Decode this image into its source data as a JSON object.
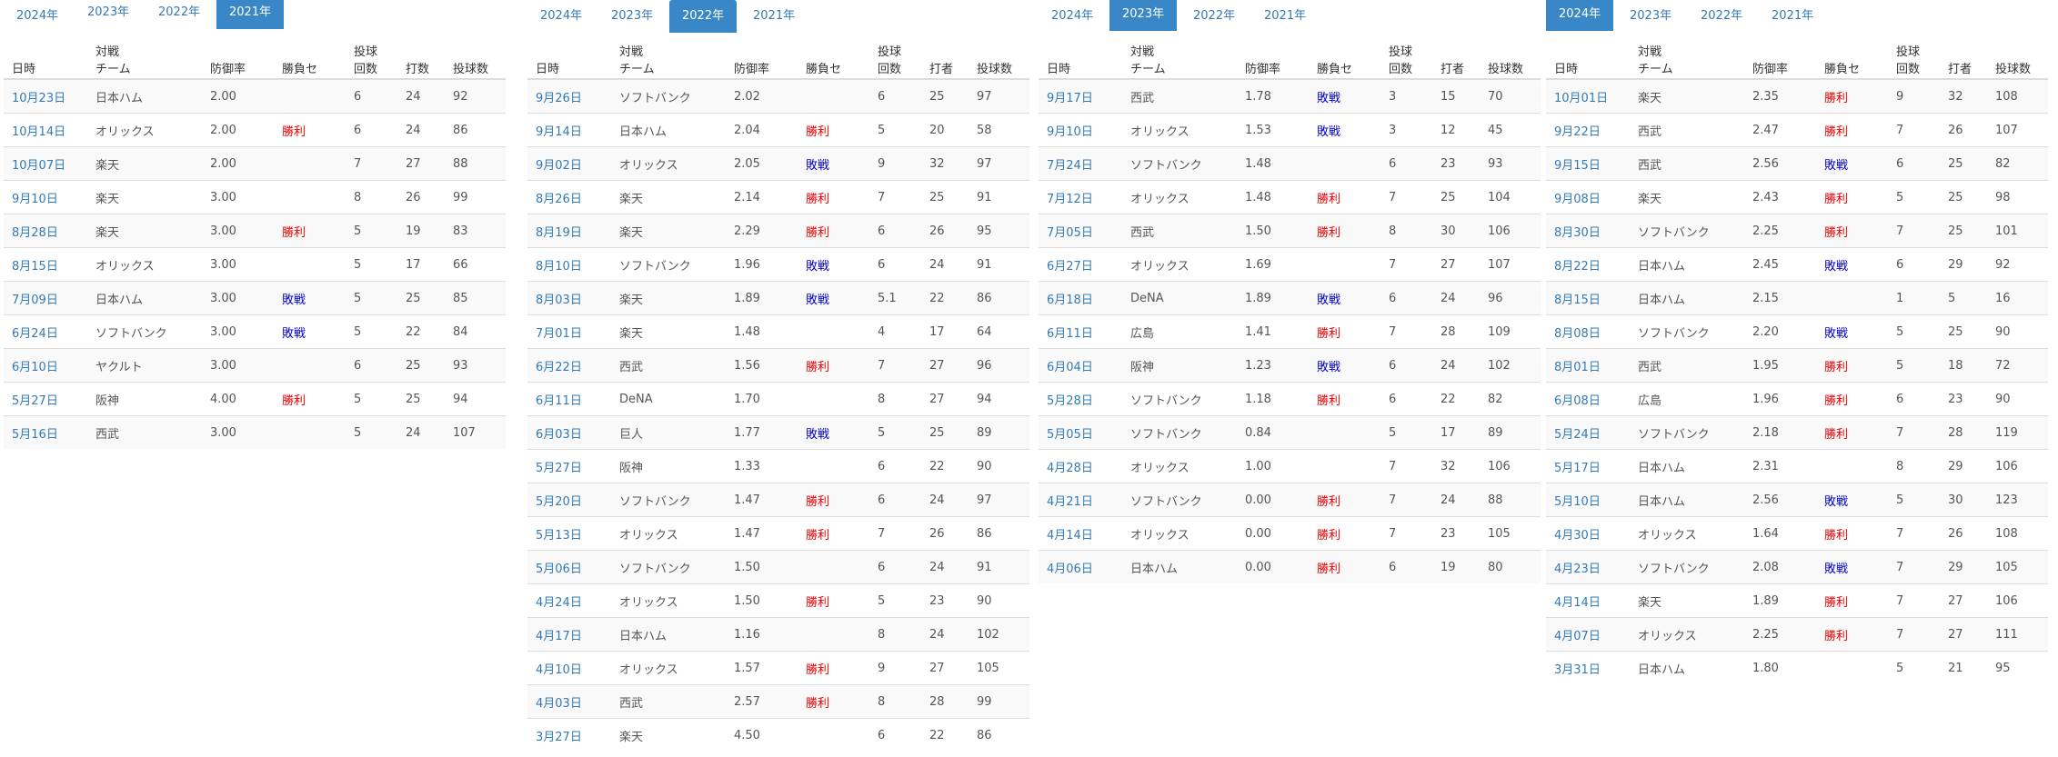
{
  "tabs": [
    "2024年",
    "2023年",
    "2022年",
    "2021年"
  ],
  "headers": {
    "date": "日時",
    "opponent_line1": "対戦",
    "opponent_line2": "チーム",
    "era": "防御率",
    "result": "勝負セ",
    "innings_line1": "投球",
    "innings_line2": "回数",
    "batters_a": "打数",
    "batters_b": "打者",
    "pitches": "投球数"
  },
  "panels": [
    {
      "active_tab": 3,
      "batters_header": "batters_a",
      "rows": [
        [
          "10月23日",
          "日本ハム",
          "2.00",
          "",
          "6",
          "24",
          "92"
        ],
        [
          "10月14日",
          "オリックス",
          "2.00",
          "勝利",
          "6",
          "24",
          "86"
        ],
        [
          "10月07日",
          "楽天",
          "2.00",
          "",
          "7",
          "27",
          "88"
        ],
        [
          "9月10日",
          "楽天",
          "3.00",
          "",
          "8",
          "26",
          "99"
        ],
        [
          "8月28日",
          "楽天",
          "3.00",
          "勝利",
          "5",
          "19",
          "83"
        ],
        [
          "8月15日",
          "オリックス",
          "3.00",
          "",
          "5",
          "17",
          "66"
        ],
        [
          "7月09日",
          "日本ハム",
          "3.00",
          "敗戦",
          "5",
          "25",
          "85"
        ],
        [
          "6月24日",
          "ソフトバンク",
          "3.00",
          "敗戦",
          "5",
          "22",
          "84"
        ],
        [
          "6月10日",
          "ヤクルト",
          "3.00",
          "",
          "6",
          "25",
          "93"
        ],
        [
          "5月27日",
          "阪神",
          "4.00",
          "勝利",
          "5",
          "25",
          "94"
        ],
        [
          "5月16日",
          "西武",
          "3.00",
          "",
          "5",
          "24",
          "107"
        ]
      ]
    },
    {
      "active_tab": 2,
      "batters_header": "batters_b",
      "rows": [
        [
          "9月26日",
          "ソフトバンク",
          "2.02",
          "",
          "6",
          "25",
          "97"
        ],
        [
          "9月14日",
          "日本ハム",
          "2.04",
          "勝利",
          "5",
          "20",
          "58"
        ],
        [
          "9月02日",
          "オリックス",
          "2.05",
          "敗戦",
          "9",
          "32",
          "97"
        ],
        [
          "8月26日",
          "楽天",
          "2.14",
          "勝利",
          "7",
          "25",
          "91"
        ],
        [
          "8月19日",
          "楽天",
          "2.29",
          "勝利",
          "6",
          "26",
          "95"
        ],
        [
          "8月10日",
          "ソフトバンク",
          "1.96",
          "敗戦",
          "6",
          "24",
          "91"
        ],
        [
          "8月03日",
          "楽天",
          "1.89",
          "敗戦",
          "5.1",
          "22",
          "86"
        ],
        [
          "7月01日",
          "楽天",
          "1.48",
          "",
          "4",
          "17",
          "64"
        ],
        [
          "6月22日",
          "西武",
          "1.56",
          "勝利",
          "7",
          "27",
          "96"
        ],
        [
          "6月11日",
          "DeNA",
          "1.70",
          "",
          "8",
          "27",
          "94"
        ],
        [
          "6月03日",
          "巨人",
          "1.77",
          "敗戦",
          "5",
          "25",
          "89"
        ],
        [
          "5月27日",
          "阪神",
          "1.33",
          "",
          "6",
          "22",
          "90"
        ],
        [
          "5月20日",
          "ソフトバンク",
          "1.47",
          "勝利",
          "6",
          "24",
          "97"
        ],
        [
          "5月13日",
          "オリックス",
          "1.47",
          "勝利",
          "7",
          "26",
          "86"
        ],
        [
          "5月06日",
          "ソフトバンク",
          "1.50",
          "",
          "6",
          "24",
          "91"
        ],
        [
          "4月24日",
          "オリックス",
          "1.50",
          "勝利",
          "5",
          "23",
          "90"
        ],
        [
          "4月17日",
          "日本ハム",
          "1.16",
          "",
          "8",
          "24",
          "102"
        ],
        [
          "4月10日",
          "オリックス",
          "1.57",
          "勝利",
          "9",
          "27",
          "105"
        ],
        [
          "4月03日",
          "西武",
          "2.57",
          "勝利",
          "8",
          "28",
          "99"
        ],
        [
          "3月27日",
          "楽天",
          "4.50",
          "",
          "6",
          "22",
          "86"
        ]
      ]
    },
    {
      "active_tab": 1,
      "batters_header": "batters_b",
      "rows": [
        [
          "9月17日",
          "西武",
          "1.78",
          "敗戦",
          "3",
          "15",
          "70"
        ],
        [
          "9月10日",
          "オリックス",
          "1.53",
          "敗戦",
          "3",
          "12",
          "45"
        ],
        [
          "7月24日",
          "ソフトバンク",
          "1.48",
          "",
          "6",
          "23",
          "93"
        ],
        [
          "7月12日",
          "オリックス",
          "1.48",
          "勝利",
          "7",
          "25",
          "104"
        ],
        [
          "7月05日",
          "西武",
          "1.50",
          "勝利",
          "8",
          "30",
          "106"
        ],
        [
          "6月27日",
          "オリックス",
          "1.69",
          "",
          "7",
          "27",
          "107"
        ],
        [
          "6月18日",
          "DeNA",
          "1.89",
          "敗戦",
          "6",
          "24",
          "96"
        ],
        [
          "6月11日",
          "広島",
          "1.41",
          "勝利",
          "7",
          "28",
          "109"
        ],
        [
          "6月04日",
          "阪神",
          "1.23",
          "敗戦",
          "6",
          "24",
          "102"
        ],
        [
          "5月28日",
          "ソフトバンク",
          "1.18",
          "勝利",
          "6",
          "22",
          "82"
        ],
        [
          "5月05日",
          "ソフトバンク",
          "0.84",
          "",
          "5",
          "17",
          "89"
        ],
        [
          "4月28日",
          "オリックス",
          "1.00",
          "",
          "7",
          "32",
          "106"
        ],
        [
          "4月21日",
          "ソフトバンク",
          "0.00",
          "勝利",
          "7",
          "24",
          "88"
        ],
        [
          "4月14日",
          "オリックス",
          "0.00",
          "勝利",
          "7",
          "23",
          "105"
        ],
        [
          "4月06日",
          "日本ハム",
          "0.00",
          "勝利",
          "6",
          "19",
          "80"
        ]
      ]
    },
    {
      "active_tab": 0,
      "batters_header": "batters_b",
      "rows": [
        [
          "10月01日",
          "楽天",
          "2.35",
          "勝利",
          "9",
          "32",
          "108"
        ],
        [
          "9月22日",
          "西武",
          "2.47",
          "勝利",
          "7",
          "26",
          "107"
        ],
        [
          "9月15日",
          "西武",
          "2.56",
          "敗戦",
          "6",
          "25",
          "82"
        ],
        [
          "9月08日",
          "楽天",
          "2.43",
          "勝利",
          "5",
          "25",
          "98"
        ],
        [
          "8月30日",
          "ソフトバンク",
          "2.25",
          "勝利",
          "7",
          "25",
          "101"
        ],
        [
          "8月22日",
          "日本ハム",
          "2.45",
          "敗戦",
          "6",
          "29",
          "92"
        ],
        [
          "8月15日",
          "日本ハム",
          "2.15",
          "",
          "1",
          "5",
          "16"
        ],
        [
          "8月08日",
          "ソフトバンク",
          "2.20",
          "敗戦",
          "5",
          "25",
          "90"
        ],
        [
          "8月01日",
          "西武",
          "1.95",
          "勝利",
          "5",
          "18",
          "72"
        ],
        [
          "6月08日",
          "広島",
          "1.96",
          "勝利",
          "6",
          "23",
          "90"
        ],
        [
          "5月24日",
          "ソフトバンク",
          "2.18",
          "勝利",
          "7",
          "28",
          "119"
        ],
        [
          "5月17日",
          "日本ハム",
          "2.31",
          "",
          "8",
          "29",
          "106"
        ],
        [
          "5月10日",
          "日本ハム",
          "2.56",
          "敗戦",
          "5",
          "30",
          "123"
        ],
        [
          "4月30日",
          "オリックス",
          "1.64",
          "勝利",
          "7",
          "26",
          "108"
        ],
        [
          "4月23日",
          "ソフトバンク",
          "2.08",
          "敗戦",
          "7",
          "29",
          "105"
        ],
        [
          "4月14日",
          "楽天",
          "1.89",
          "勝利",
          "7",
          "27",
          "106"
        ],
        [
          "4月07日",
          "オリックス",
          "2.25",
          "勝利",
          "7",
          "27",
          "111"
        ],
        [
          "3月31日",
          "日本ハム",
          "1.80",
          "",
          "5",
          "21",
          "95"
        ]
      ]
    }
  ],
  "result_colors": {
    "win_label": "勝利",
    "win": "#e60000",
    "lose": "#0000cc",
    "link": "#337ab7",
    "active_tab": "#3a87c8"
  }
}
